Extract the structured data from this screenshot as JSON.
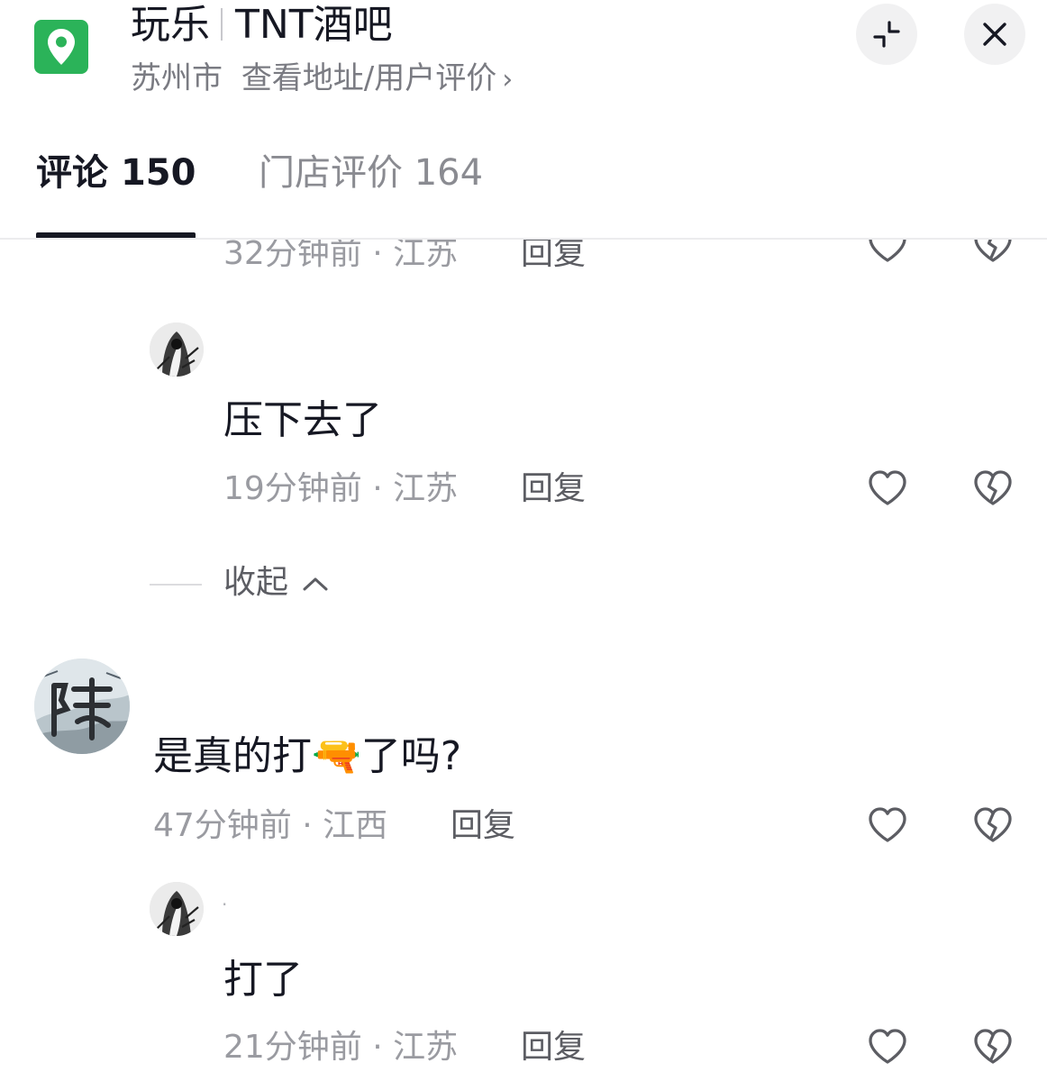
{
  "header": {
    "category": "玩乐",
    "place_name": "TNT酒吧",
    "city": "苏州市",
    "address_link": "查看地址/用户评价",
    "chevron": "›",
    "icons": {
      "location": "location-pin-icon",
      "collapse": "collapse-icon",
      "close": "close-icon"
    },
    "brand_color": "#2bb359"
  },
  "tabs": [
    {
      "label": "评论",
      "count": "150",
      "active": true
    },
    {
      "label": "门店评价",
      "count": "164",
      "active": false
    }
  ],
  "comments": [
    {
      "meta": "32分钟前 · 江苏",
      "reply": "回复",
      "partial": true
    },
    {
      "text": "压下去了",
      "meta": "19分钟前 · 江苏",
      "reply": "回复",
      "avatar": "ink-portrait-avatar"
    },
    {
      "collapse": "收起"
    },
    {
      "text": "是真的打",
      "text_emoji": "🔫",
      "text_after": "了吗?",
      "meta": "47分钟前 · 江西",
      "reply": "回复",
      "avatar": "ink-landscape-avatar"
    },
    {
      "name": "·",
      "text": "打了",
      "meta": "21分钟前 · 江苏",
      "reply": "回复",
      "avatar": "ink-portrait-avatar"
    }
  ],
  "actions": {
    "like_icon": "heart-icon",
    "dislike_icon": "broken-heart-icon"
  }
}
